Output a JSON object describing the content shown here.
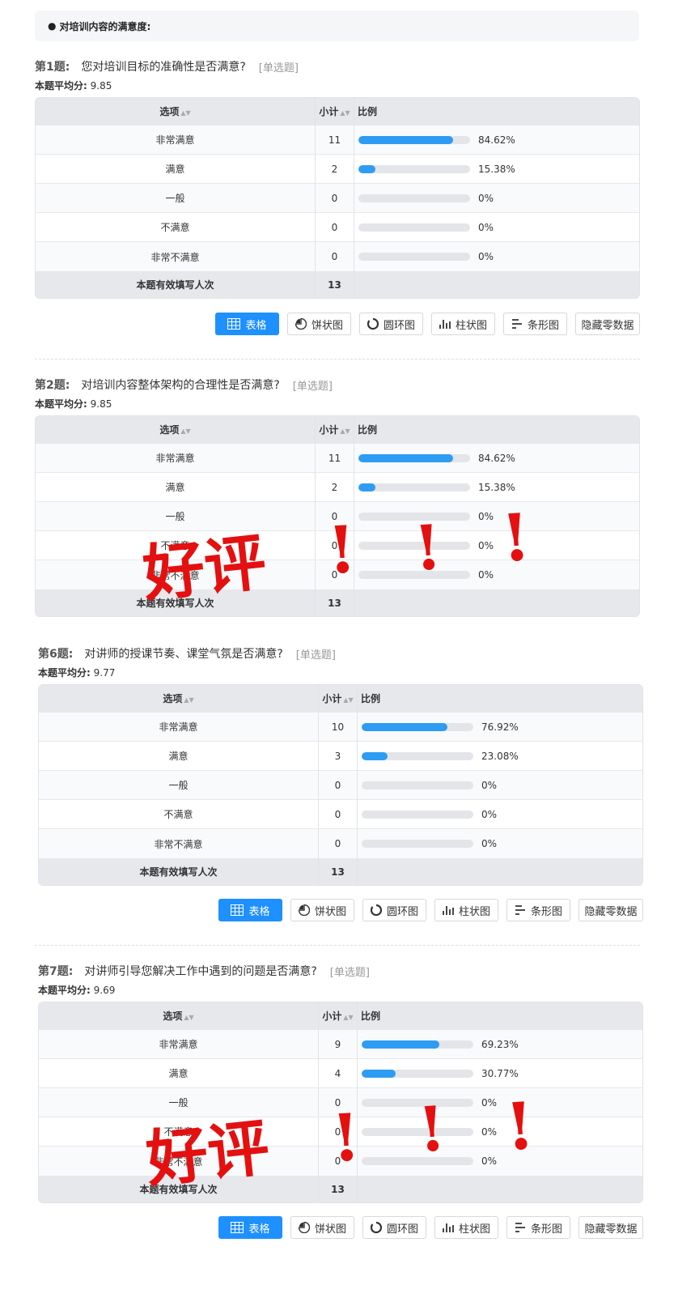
{
  "section": {
    "bullet": "●",
    "title": "对培训内容的满意度:"
  },
  "columns": {
    "option": "选项",
    "count": "小计",
    "ratio": "比例"
  },
  "sort_icon": "▲▼",
  "footer_label": "本题有效填写人次",
  "avg_label": "本题平均分:",
  "type_label": "[单选题]",
  "toolbar": {
    "buttons": [
      {
        "label": "表格",
        "icon": "table-icon",
        "active": true
      },
      {
        "label": "饼状图",
        "icon": "pie-chart-icon"
      },
      {
        "label": "圆环图",
        "icon": "ring-chart-icon"
      },
      {
        "label": "柱状图",
        "icon": "column-chart-icon"
      },
      {
        "label": "条形图",
        "icon": "bar-chart-icon"
      },
      {
        "label": "隐藏零数据",
        "icon": ""
      }
    ]
  },
  "questions": [
    {
      "num": "第1题:",
      "text": "您对培训目标的准确性是否满意?",
      "avg": "9.85",
      "total": "13",
      "rows": [
        {
          "option": "非常满意",
          "count": "11",
          "percent": "84.62%",
          "fraction": 0.8462
        },
        {
          "option": "满意",
          "count": "2",
          "percent": "15.38%",
          "fraction": 0.1538
        },
        {
          "option": "一般",
          "count": "0",
          "percent": "0%",
          "fraction": 0
        },
        {
          "option": "不满意",
          "count": "0",
          "percent": "0%",
          "fraction": 0
        },
        {
          "option": "非常不满意",
          "count": "0",
          "percent": "0%",
          "fraction": 0
        }
      ]
    },
    {
      "num": "第2题:",
      "text": "对培训内容整体架构的合理性是否满意?",
      "avg": "9.85",
      "total": "13",
      "rows": [
        {
          "option": "非常满意",
          "count": "11",
          "percent": "84.62%",
          "fraction": 0.8462
        },
        {
          "option": "满意",
          "count": "2",
          "percent": "15.38%",
          "fraction": 0.1538
        },
        {
          "option": "一般",
          "count": "0",
          "percent": "0%",
          "fraction": 0
        },
        {
          "option": "不满意",
          "count": "0",
          "percent": "0%",
          "fraction": 0
        },
        {
          "option": "非常不满意",
          "count": "0",
          "percent": "0%",
          "fraction": 0
        }
      ]
    },
    {
      "num": "第6题:",
      "text": "对讲师的授课节奏、课堂气氛是否满意?",
      "avg": "9.77",
      "total": "13",
      "rows": [
        {
          "option": "非常满意",
          "count": "10",
          "percent": "76.92%",
          "fraction": 0.7692
        },
        {
          "option": "满意",
          "count": "3",
          "percent": "23.08%",
          "fraction": 0.2308
        },
        {
          "option": "一般",
          "count": "0",
          "percent": "0%",
          "fraction": 0
        },
        {
          "option": "不满意",
          "count": "0",
          "percent": "0%",
          "fraction": 0
        },
        {
          "option": "非常不满意",
          "count": "0",
          "percent": "0%",
          "fraction": 0
        }
      ]
    },
    {
      "num": "第7题:",
      "text": "对讲师引导您解决工作中遇到的问题是否满意?",
      "avg": "9.69",
      "total": "13",
      "rows": [
        {
          "option": "非常满意",
          "count": "9",
          "percent": "69.23%",
          "fraction": 0.6923
        },
        {
          "option": "满意",
          "count": "4",
          "percent": "30.77%",
          "fraction": 0.3077
        },
        {
          "option": "一般",
          "count": "0",
          "percent": "0%",
          "fraction": 0
        },
        {
          "option": "不满意",
          "count": "0",
          "percent": "0%",
          "fraction": 0
        },
        {
          "option": "非常不满意",
          "count": "0",
          "percent": "0%",
          "fraction": 0
        }
      ]
    }
  ],
  "overlay": {
    "text": "好评",
    "marks": [
      "!",
      "!",
      "!"
    ],
    "color": "#e41010"
  }
}
